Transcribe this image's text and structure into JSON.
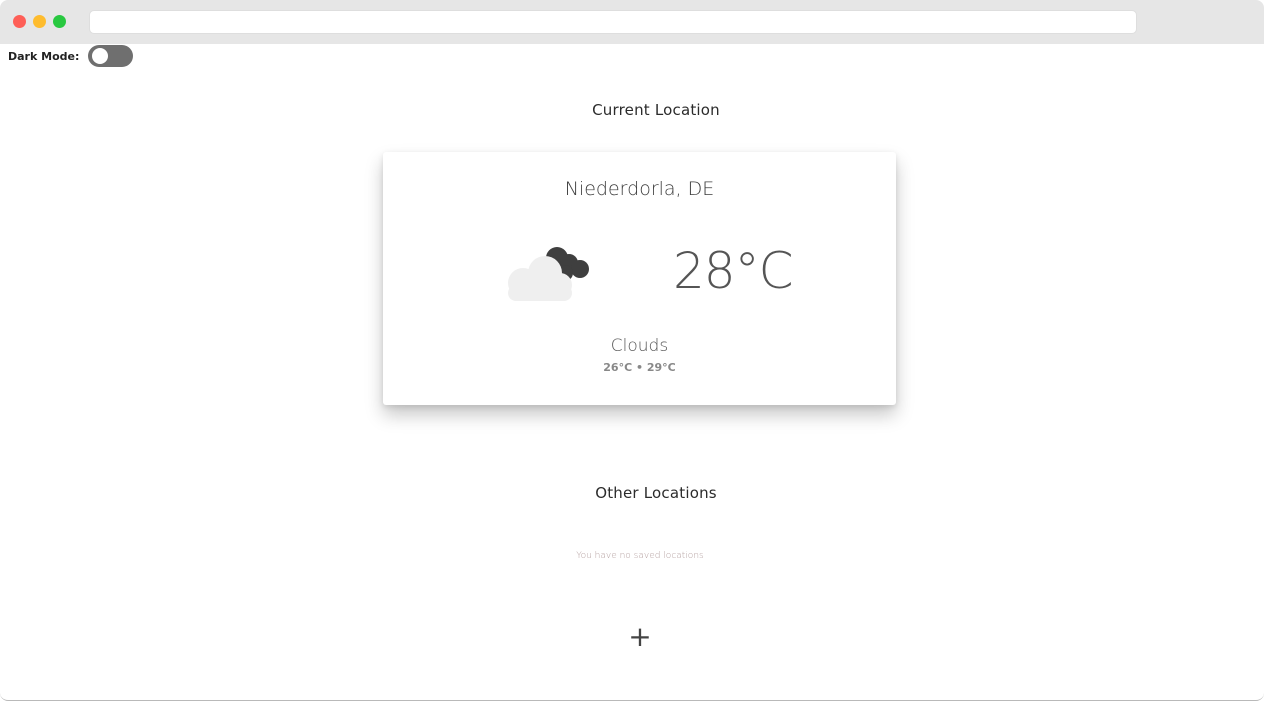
{
  "window": {
    "traffic_lights": [
      "close",
      "minimize",
      "zoom"
    ],
    "url": ""
  },
  "settings": {
    "dark_mode_label": "Dark Mode:",
    "dark_mode_enabled": false
  },
  "current_location": {
    "heading": "Current Location",
    "city": "Niederdorla, DE",
    "icon": "clouds-icon",
    "temperature": "28°C",
    "condition": "Clouds",
    "range": "26°C • 29°C"
  },
  "other_locations": {
    "heading": "Other Locations",
    "empty_message": "You have no saved locations",
    "add_label": "+"
  },
  "colors": {
    "titlebar": "#e6e6e6",
    "toggle_off": "#6f6f6f",
    "close": "#fe5f57",
    "minimize": "#febc2e",
    "zoom": "#28c840"
  }
}
